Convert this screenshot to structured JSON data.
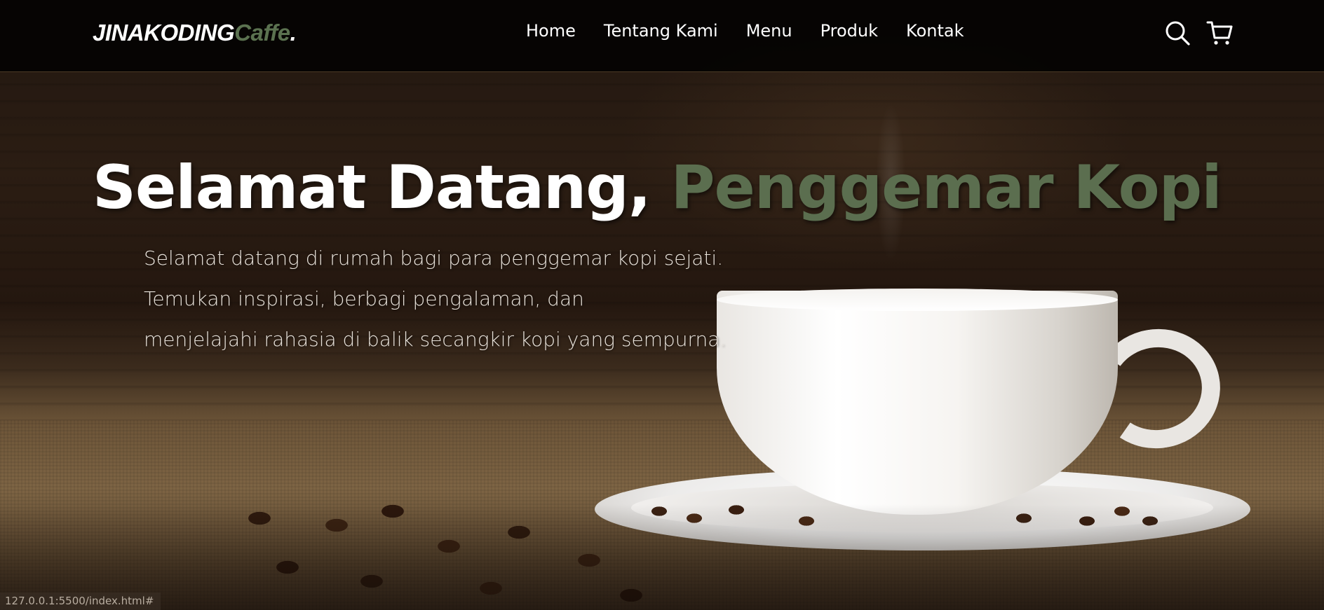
{
  "brand": {
    "name_main": "JINAKODING",
    "name_accent": "Caffe",
    "name_dot": ".",
    "accent_color": "#5b7250"
  },
  "nav": {
    "links": [
      {
        "label": "Home"
      },
      {
        "label": "Tentang Kami"
      },
      {
        "label": "Menu"
      },
      {
        "label": "Produk"
      },
      {
        "label": "Kontak"
      }
    ],
    "icons": [
      "search-icon",
      "cart-icon"
    ]
  },
  "hero": {
    "title_main": "Selamat Datang, ",
    "title_accent": "Penggemar Kopi",
    "lines": [
      "Selamat datang di rumah bagi para penggemar kopi sejati.",
      "Temukan inspirasi, berbagi pengalaman, dan",
      "menjelajahi rahasia di balik secangkir kopi yang sempurna."
    ]
  },
  "status_bar": {
    "url": "127.0.0.1:5500/index.html#"
  }
}
